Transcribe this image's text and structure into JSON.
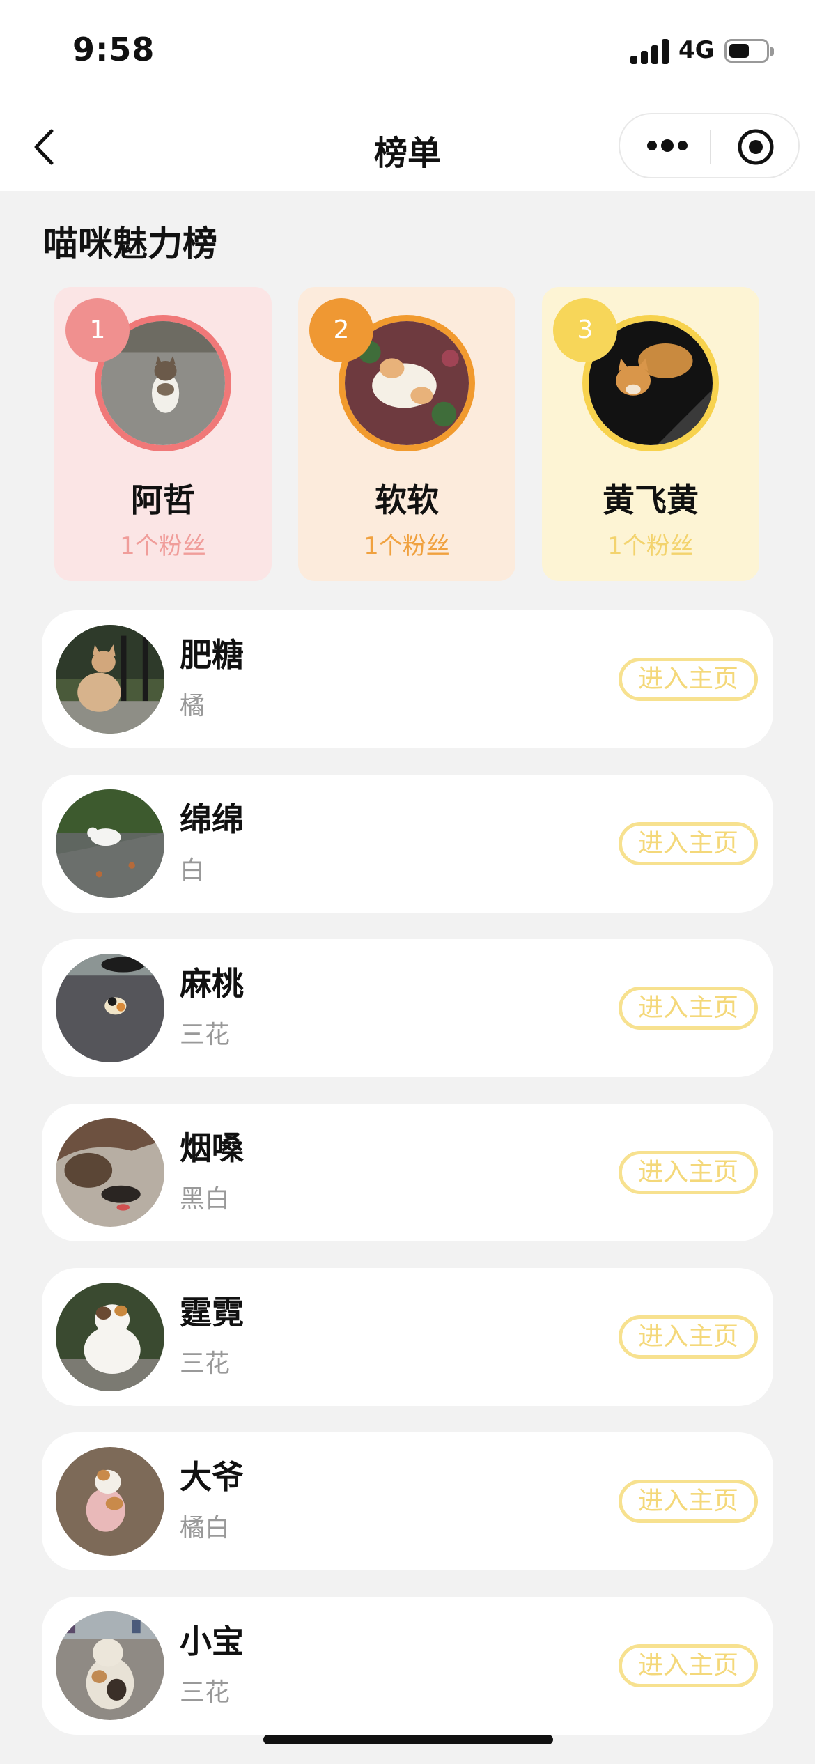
{
  "status_bar": {
    "time": "9:58",
    "network": "4G",
    "battery_level": 0.55
  },
  "nav": {
    "title": "榜单",
    "back_icon": "chevron-left-icon",
    "more_icon": "more-dots-icon",
    "close_icon": "target-circle-icon"
  },
  "section": {
    "title": "喵咪魅力榜"
  },
  "top3": [
    {
      "rank": "1",
      "name": "阿哲",
      "fans": "1个粉丝",
      "accent": "#f07878"
    },
    {
      "rank": "2",
      "name": "软软",
      "fans": "1个粉丝",
      "accent": "#f19a2e"
    },
    {
      "rank": "3",
      "name": "黄飞黄",
      "fans": "1个粉丝",
      "accent": "#f7d24d"
    }
  ],
  "list": [
    {
      "name": "肥糖",
      "color": "橘",
      "button": "进入主页"
    },
    {
      "name": "绵绵",
      "color": "白",
      "button": "进入主页"
    },
    {
      "name": "麻桃",
      "color": "三花",
      "button": "进入主页"
    },
    {
      "name": "烟嗓",
      "color": "黑白",
      "button": "进入主页"
    },
    {
      "name": "霆霓",
      "color": "三花",
      "button": "进入主页"
    },
    {
      "name": "大爷",
      "color": "橘白",
      "button": "进入主页"
    },
    {
      "name": "小宝",
      "color": "三花",
      "button": "进入主页"
    }
  ]
}
